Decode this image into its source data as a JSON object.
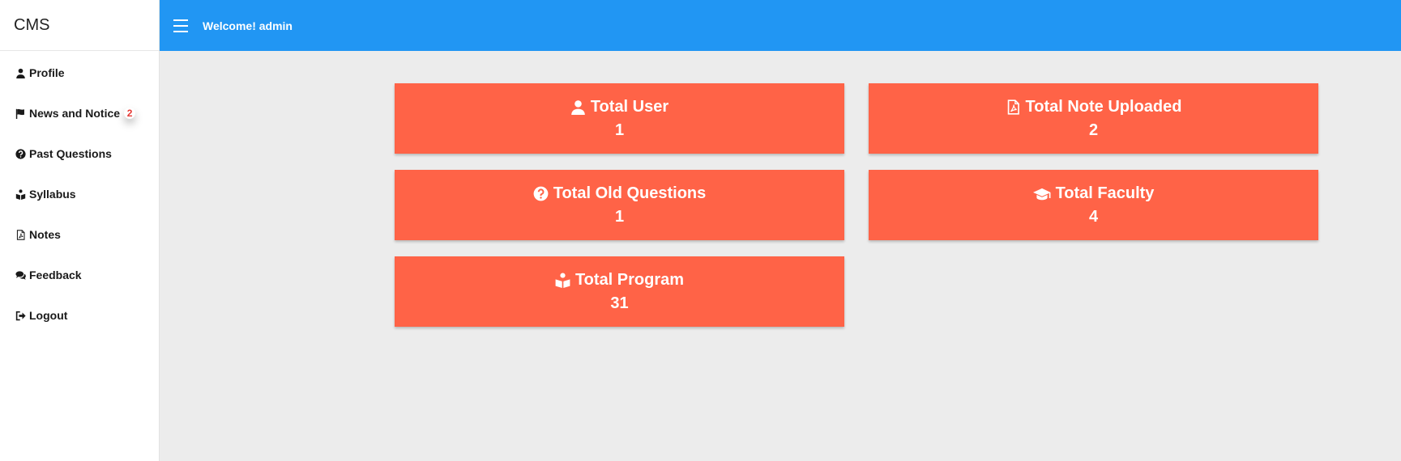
{
  "brand": "CMS",
  "header": {
    "welcome": "Welcome! admin"
  },
  "sidebar": {
    "items": [
      {
        "label": "Profile",
        "icon": "user-icon"
      },
      {
        "label": "News and Notice",
        "icon": "flag-icon",
        "badge": "2"
      },
      {
        "label": "Past Questions",
        "icon": "question-circle-icon"
      },
      {
        "label": "Syllabus",
        "icon": "book-reader-icon"
      },
      {
        "label": "Notes",
        "icon": "file-pdf-icon"
      },
      {
        "label": "Feedback",
        "icon": "comments-icon"
      },
      {
        "label": "Logout",
        "icon": "sign-out-icon"
      }
    ]
  },
  "stats": {
    "users": {
      "title": "Total User",
      "value": "1",
      "icon": "user-icon"
    },
    "notes": {
      "title": "Total Note Uploaded",
      "value": "2",
      "icon": "file-pdf-icon"
    },
    "questions": {
      "title": "Total Old Questions",
      "value": "1",
      "icon": "question-circle-icon"
    },
    "faculty": {
      "title": "Total Faculty",
      "value": "4",
      "icon": "graduation-cap-icon"
    },
    "program": {
      "title": "Total Program",
      "value": "31",
      "icon": "book-reader-icon"
    }
  },
  "colors": {
    "topbar": "#2196f3",
    "card": "#ff6347",
    "badge": "#e53935",
    "background": "#ececec"
  }
}
